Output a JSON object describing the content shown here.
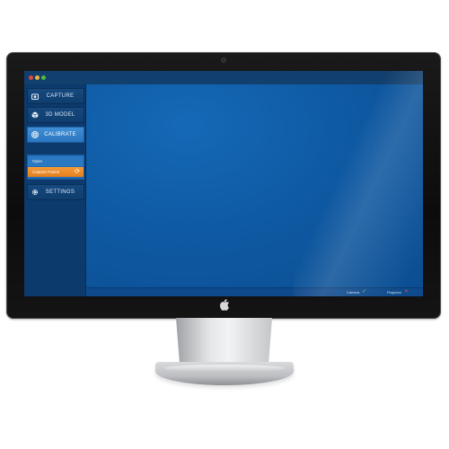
{
  "sidebar": {
    "items": [
      {
        "label": "CAPTURE",
        "icon": "camera-icon"
      },
      {
        "label": "3D MODEL",
        "icon": "cube-icon"
      },
      {
        "label": "CALIBRATE",
        "icon": "target-icon"
      },
      {
        "label": "SETTINGS",
        "icon": "gear-icon"
      }
    ],
    "active": "CALIBRATE"
  },
  "calibrate_menu": {
    "open_label": "Open",
    "capture_label": "Capture Frame"
  },
  "status": {
    "camera_label": "Camera",
    "projector_label": "Projector"
  },
  "colors": {
    "accent": "#2b76c0",
    "highlight": "#e37f1c",
    "background": "#0b4e92"
  }
}
